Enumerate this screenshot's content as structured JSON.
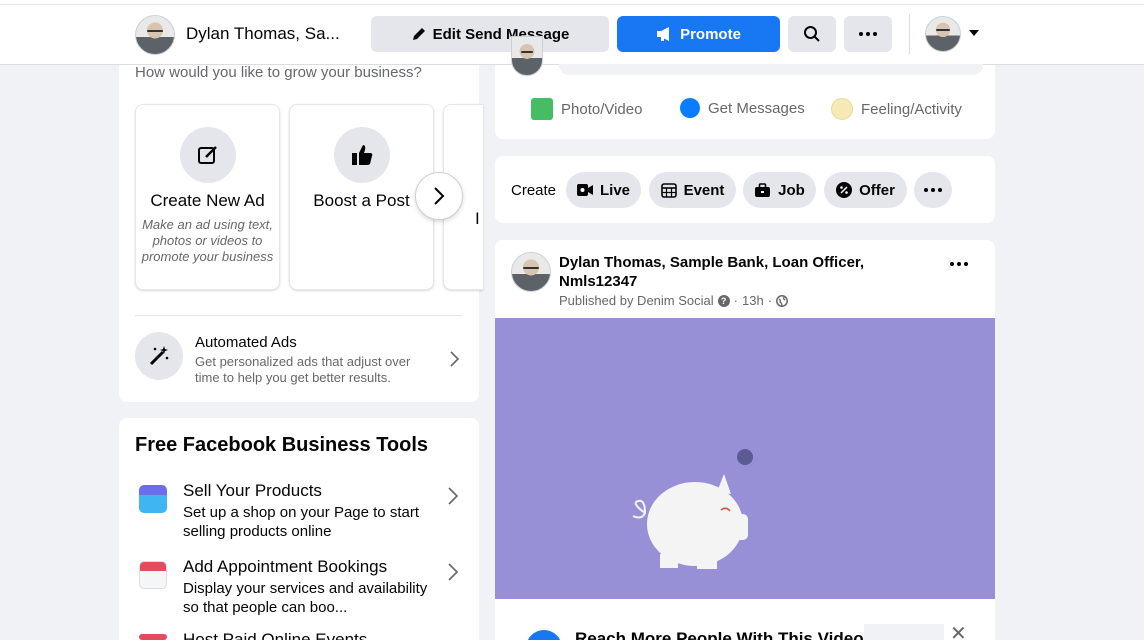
{
  "topbar": {
    "page_name": "Dylan Thomas, Sa...",
    "edit_button": "Edit Send Message",
    "promote_button": "Promote",
    "colors": {
      "accent": "#1877f2",
      "grey_button": "#e4e6eb"
    }
  },
  "left": {
    "grow_question": "How would you like to grow your business?",
    "tiles": [
      {
        "title": "Create New Ad",
        "description": "Make an ad using text, photos or videos to promote your business"
      },
      {
        "title": "Boost a Post",
        "description": ""
      },
      {
        "title": "I",
        "description": ""
      }
    ],
    "automated": {
      "title": "Automated Ads",
      "description": "Get personalized ads that adjust over time to help you get better results."
    },
    "tools": {
      "title": "Free Facebook Business Tools",
      "items": [
        {
          "title": "Sell Your Products",
          "description": "Set up a shop on your Page to start selling products online",
          "icon": "shop-icon"
        },
        {
          "title": "Add Appointment Bookings",
          "description": "Display your services and availability so that people can boo...",
          "icon": "calendar-icon"
        },
        {
          "title": "Host Paid Online Events",
          "description": "",
          "icon": "event-icon"
        }
      ]
    }
  },
  "composer": {
    "actions": [
      {
        "label": "Photo/Video",
        "icon": "photo-video-icon",
        "color": "#45bd62"
      },
      {
        "label": "Get Messages",
        "icon": "messenger-icon",
        "color": "#0a7cff"
      },
      {
        "label": "Feeling/Activity",
        "icon": "feeling-icon",
        "color": "#f7b928"
      }
    ]
  },
  "create_bar": {
    "label": "Create",
    "chips": [
      {
        "label": "Live",
        "icon": "live-icon"
      },
      {
        "label": "Event",
        "icon": "event-calendar-icon"
      },
      {
        "label": "Job",
        "icon": "job-icon"
      },
      {
        "label": "Offer",
        "icon": "offer-icon"
      }
    ]
  },
  "post": {
    "author": "Dylan Thomas, Sample Bank, Loan Officer, Nmls12347",
    "published_by": "Published by Denim Social",
    "time": "13h",
    "video_background": "#9890d6",
    "promo_title": "Reach More People With This Video"
  }
}
